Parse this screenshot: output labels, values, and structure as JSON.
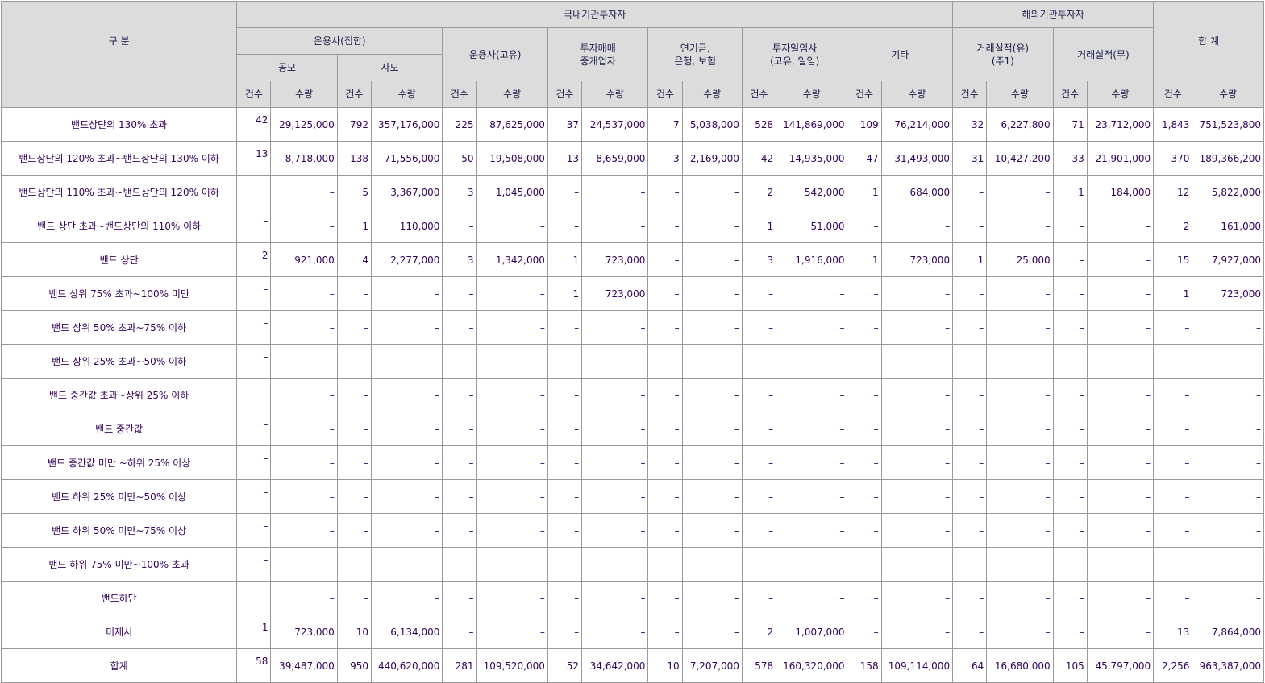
{
  "headers": {
    "category": "구 분",
    "domestic": "국내기관투자자",
    "foreign": "해외기관투자자",
    "total": "합 계",
    "collective": "운용사(집합)",
    "public": "공모",
    "private": "사모",
    "proprietary": "운용사(고유)",
    "broker_line1": "투자매매",
    "broker_line2": "중개업자",
    "pension_line1": "연기금,",
    "pension_line2": "은행, 보험",
    "general_line1": "투자일임사",
    "general_line2": "(고유, 일임)",
    "other": "기타",
    "record_yes_line1": "거래실적(유)",
    "record_yes_line2": "(주1)",
    "record_no": "거래실적(무)",
    "count": "건수",
    "quantity": "수량"
  },
  "rows": [
    {
      "label": "밴드상단의 130% 초과",
      "top": true,
      "cells": [
        "42",
        "29,125,000",
        "792",
        "357,176,000",
        "225",
        "87,625,000",
        "37",
        "24,537,000",
        "7",
        "5,038,000",
        "528",
        "141,869,000",
        "109",
        "76,214,000",
        "32",
        "6,227,800",
        "71",
        "23,712,000",
        "1,843",
        "751,523,800"
      ]
    },
    {
      "label": "밴드상단의 120% 초과~밴드상단의 130% 이하",
      "top": true,
      "cells": [
        "13",
        "8,718,000",
        "138",
        "71,556,000",
        "50",
        "19,508,000",
        "13",
        "8,659,000",
        "3",
        "2,169,000",
        "42",
        "14,935,000",
        "47",
        "31,493,000",
        "31",
        "10,427,200",
        "33",
        "21,901,000",
        "370",
        "189,366,200"
      ]
    },
    {
      "label": "밴드상단의 110% 초과~밴드상단의 120% 이하",
      "top": true,
      "cells": [
        "–",
        "–",
        "5",
        "3,367,000",
        "3",
        "1,045,000",
        "–",
        "–",
        "–",
        "–",
        "2",
        "542,000",
        "1",
        "684,000",
        "–",
        "–",
        "1",
        "184,000",
        "12",
        "5,822,000"
      ]
    },
    {
      "label": "밴드 상단 초과~밴드상단의 110% 이하",
      "top": true,
      "cells": [
        "–",
        "–",
        "1",
        "110,000",
        "–",
        "–",
        "–",
        "–",
        "–",
        "–",
        "1",
        "51,000",
        "–",
        "–",
        "–",
        "–",
        "–",
        "–",
        "2",
        "161,000"
      ]
    },
    {
      "label": "밴드 상단",
      "top": true,
      "cells": [
        "2",
        "921,000",
        "4",
        "2,277,000",
        "3",
        "1,342,000",
        "1",
        "723,000",
        "–",
        "–",
        "3",
        "1,916,000",
        "1",
        "723,000",
        "1",
        "25,000",
        "–",
        "–",
        "15",
        "7,927,000"
      ]
    },
    {
      "label": "밴드 상위 75% 초과~100% 미만",
      "top": true,
      "cells": [
        "–",
        "–",
        "–",
        "–",
        "–",
        "–",
        "1",
        "723,000",
        "–",
        "–",
        "–",
        "–",
        "–",
        "–",
        "–",
        "–",
        "–",
        "–",
        "1",
        "723,000"
      ]
    },
    {
      "label": "밴드 상위 50% 초과~75% 이하",
      "top": true,
      "cells": [
        "–",
        "–",
        "–",
        "–",
        "–",
        "–",
        "–",
        "–",
        "–",
        "–",
        "–",
        "–",
        "–",
        "–",
        "–",
        "–",
        "–",
        "–",
        "–",
        "–"
      ]
    },
    {
      "label": "밴드 상위 25% 초과~50% 이하",
      "top": true,
      "cells": [
        "–",
        "–",
        "–",
        "–",
        "–",
        "–",
        "–",
        "–",
        "–",
        "–",
        "–",
        "–",
        "–",
        "–",
        "–",
        "–",
        "–",
        "–",
        "–",
        "–"
      ]
    },
    {
      "label": "밴드 중간값 초과~상위 25% 이하",
      "top": true,
      "cells": [
        "–",
        "–",
        "–",
        "–",
        "–",
        "–",
        "–",
        "–",
        "–",
        "–",
        "–",
        "–",
        "–",
        "–",
        "–",
        "–",
        "–",
        "–",
        "–",
        "–"
      ]
    },
    {
      "label": "밴드 중간값",
      "top": true,
      "cells": [
        "–",
        "–",
        "–",
        "–",
        "–",
        "–",
        "–",
        "–",
        "–",
        "–",
        "–",
        "–",
        "–",
        "–",
        "–",
        "–",
        "–",
        "–",
        "–",
        "–"
      ]
    },
    {
      "label": "밴드 중간값 미만 ~하위 25% 이상",
      "top": true,
      "cells": [
        "–",
        "–",
        "–",
        "–",
        "–",
        "–",
        "–",
        "–",
        "–",
        "–",
        "–",
        "–",
        "–",
        "–",
        "–",
        "–",
        "–",
        "–",
        "–",
        "–"
      ]
    },
    {
      "label": "밴드 하위 25% 미만~50% 이상",
      "top": true,
      "cells": [
        "–",
        "–",
        "–",
        "–",
        "–",
        "–",
        "–",
        "–",
        "–",
        "–",
        "–",
        "–",
        "–",
        "–",
        "–",
        "–",
        "–",
        "–",
        "–",
        "–"
      ]
    },
    {
      "label": "밴드 하위 50% 미만~75% 이상",
      "top": true,
      "cells": [
        "–",
        "–",
        "–",
        "–",
        "–",
        "–",
        "–",
        "–",
        "–",
        "–",
        "–",
        "–",
        "–",
        "–",
        "–",
        "–",
        "–",
        "–",
        "–",
        "–"
      ]
    },
    {
      "label": "밴드 하위 75% 미만~100% 초과",
      "top": true,
      "cells": [
        "–",
        "–",
        "–",
        "–",
        "–",
        "–",
        "–",
        "–",
        "–",
        "–",
        "–",
        "–",
        "–",
        "–",
        "–",
        "–",
        "–",
        "–",
        "–",
        "–"
      ]
    },
    {
      "label": "밴드하단",
      "top": true,
      "cells": [
        "–",
        "–",
        "–",
        "–",
        "–",
        "–",
        "–",
        "–",
        "–",
        "–",
        "–",
        "–",
        "–",
        "–",
        "–",
        "–",
        "–",
        "–",
        "–",
        "–"
      ]
    },
    {
      "label": "미제시",
      "top": true,
      "cells": [
        "1",
        "723,000",
        "10",
        "6,134,000",
        "–",
        "–",
        "–",
        "–",
        "–",
        "–",
        "2",
        "1,007,000",
        "–",
        "–",
        "–",
        "–",
        "–",
        "–",
        "13",
        "7,864,000"
      ]
    },
    {
      "label": "합계",
      "top": true,
      "cells": [
        "58",
        "39,487,000",
        "950",
        "440,620,000",
        "281",
        "109,520,000",
        "52",
        "34,642,000",
        "10",
        "7,207,000",
        "578",
        "160,320,000",
        "158",
        "109,114,000",
        "64",
        "16,680,000",
        "105",
        "45,797,000",
        "2,256",
        "963,387,000"
      ]
    }
  ]
}
